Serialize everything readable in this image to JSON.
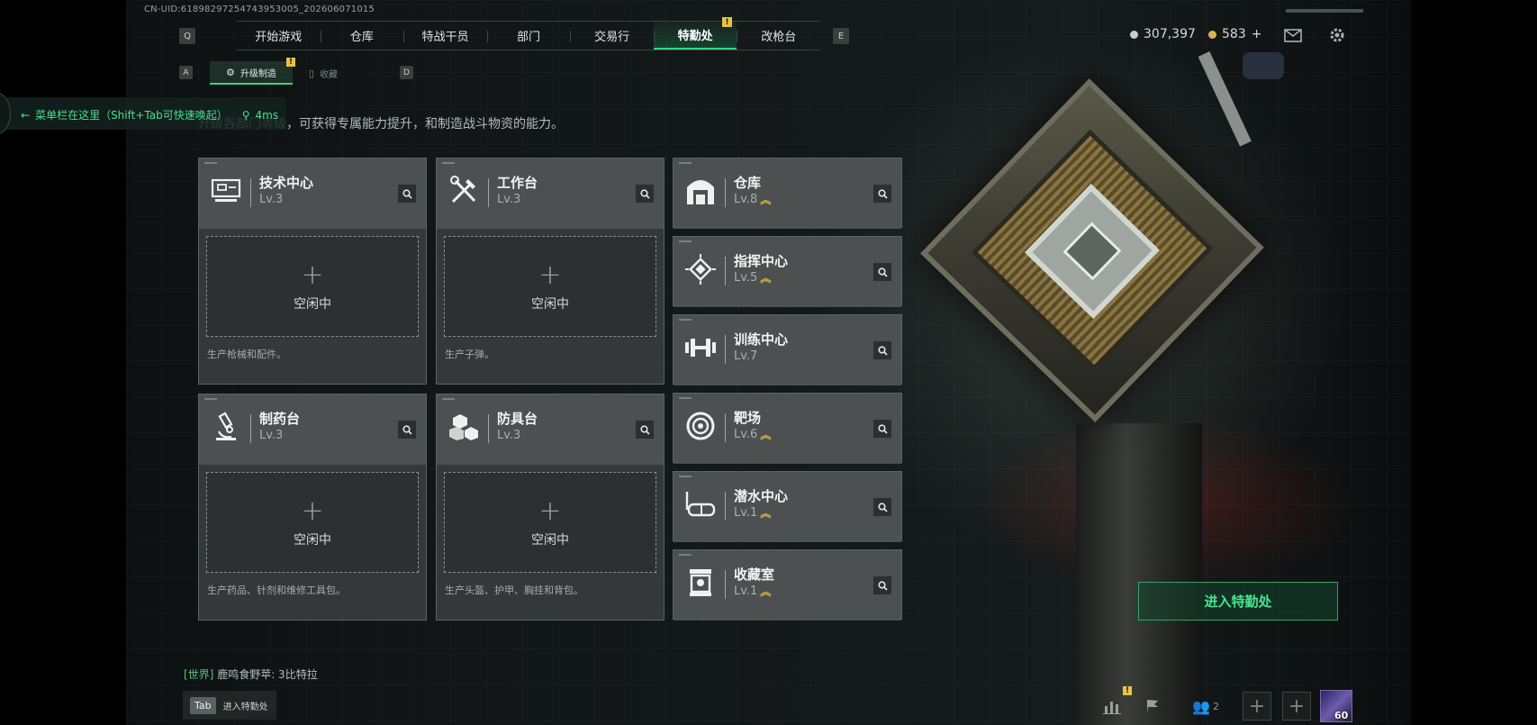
{
  "uid": "CN-UID:6189829725474395300​5_202606071015",
  "nav": {
    "key_left": "Q",
    "key_right": "E",
    "tabs": [
      "开始游戏",
      "仓库",
      "特战干员",
      "部门",
      "交易行",
      "特勤处",
      "改枪台"
    ],
    "active_index": 5,
    "alert_badge": "!"
  },
  "currency": {
    "silver": "307,397",
    "gold": "583",
    "gold_add": "+"
  },
  "subnav": {
    "key_left": "A",
    "key_right": "D",
    "tabs": [
      "升级制造",
      "收藏"
    ],
    "alert_badge": "!"
  },
  "menu_hint": {
    "text": "菜单栏在这里（Shift+Tab可快速唤起）",
    "ping": "4ms"
  },
  "subtitle": "升级各部门等级，可获得专属能力提升，和制造战斗物资的能力。",
  "production_cards": [
    {
      "name": "技术中心",
      "level": "Lv.3",
      "icon": "monitor-icon",
      "slot": "空闲中",
      "desc": "生产枪械和配件。"
    },
    {
      "name": "工作台",
      "level": "Lv.3",
      "icon": "tools-icon",
      "slot": "空闲中",
      "desc": "生产子弹。"
    },
    {
      "name": "制药台",
      "level": "Lv.3",
      "icon": "microscope-icon",
      "slot": "空闲中",
      "desc": "生产药品、针剂和维修工具包。"
    },
    {
      "name": "防具台",
      "level": "Lv.3",
      "icon": "cubes-icon",
      "slot": "空闲中",
      "desc": "生产头盔、护甲、胸挂和背包。"
    }
  ],
  "facilities": [
    {
      "name": "仓库",
      "level": "Lv.8",
      "upgradable": true,
      "icon": "warehouse-icon"
    },
    {
      "name": "指挥中心",
      "level": "Lv.5",
      "upgradable": true,
      "icon": "chip-icon"
    },
    {
      "name": "训练中心",
      "level": "Lv.7",
      "upgradable": false,
      "icon": "dumbbell-icon"
    },
    {
      "name": "靶场",
      "level": "Lv.6",
      "upgradable": true,
      "icon": "target-icon"
    },
    {
      "name": "潜水中心",
      "level": "Lv.1",
      "upgradable": true,
      "icon": "diving-mask-icon"
    },
    {
      "name": "收藏室",
      "level": "Lv.1",
      "upgradable": true,
      "icon": "showcase-icon"
    }
  ],
  "enter_button": "进入特勤处",
  "chat": {
    "channel": "[世界]",
    "message": "鹿鸣食野苹: 3比特拉"
  },
  "tab_hint": {
    "key": "Tab",
    "label": "进入特勤处"
  },
  "bottom_bar": {
    "friends_count": "2",
    "avatar_level": "60",
    "alert_badge": "!"
  },
  "colors": {
    "accent": "#38d488",
    "upgrade": "#e1b43e",
    "badge": "#e8c341"
  }
}
